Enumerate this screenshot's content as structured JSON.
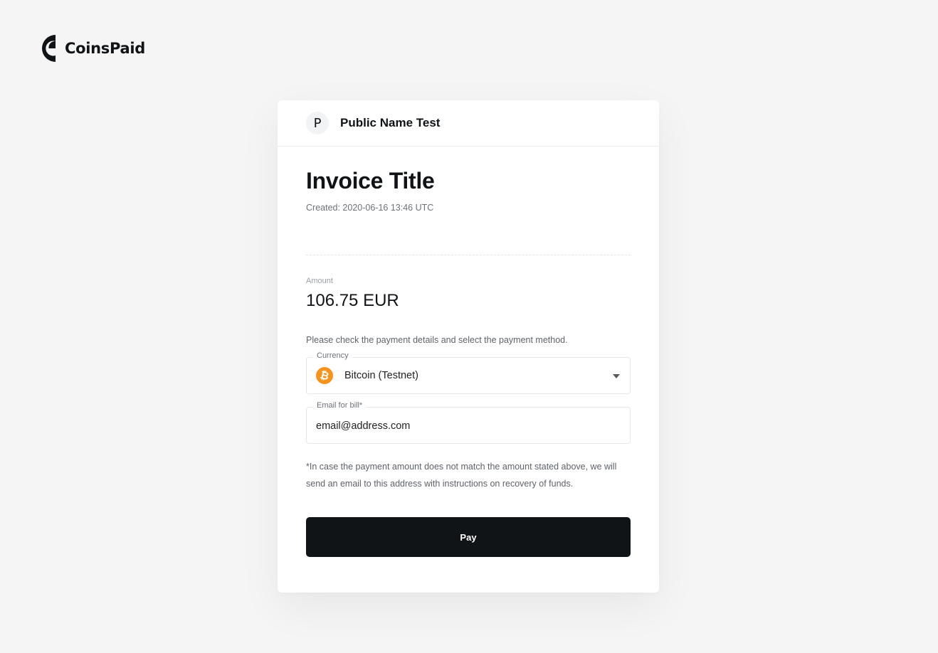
{
  "brand": {
    "name": "CoinsPaid",
    "logo_icon": "coinspaid-logo-icon"
  },
  "merchant": {
    "avatar_letter": "P",
    "name": "Public Name Test"
  },
  "invoice": {
    "title": "Invoice Title",
    "created": "Created: 2020-06-16 13:46 UTC",
    "amount_label": "Amount",
    "amount_value": "106.75 EUR",
    "instruction": "Please check the payment details and select the payment method."
  },
  "currency_field": {
    "label": "Currency",
    "icon": "bitcoin-icon",
    "icon_glyph": "₿",
    "value": "Bitcoin (Testnet)"
  },
  "email_field": {
    "label": "Email for bill*",
    "value": "email@address.com"
  },
  "note": "*In case the payment amount does not match the amount stated above, we will send an email to this address with instructions on recovery of funds.",
  "pay_button": {
    "label": "Pay"
  },
  "colors": {
    "background": "#f5f5f5",
    "card": "#ffffff",
    "primary_button": "#111417",
    "bitcoin": "#f7931a"
  }
}
